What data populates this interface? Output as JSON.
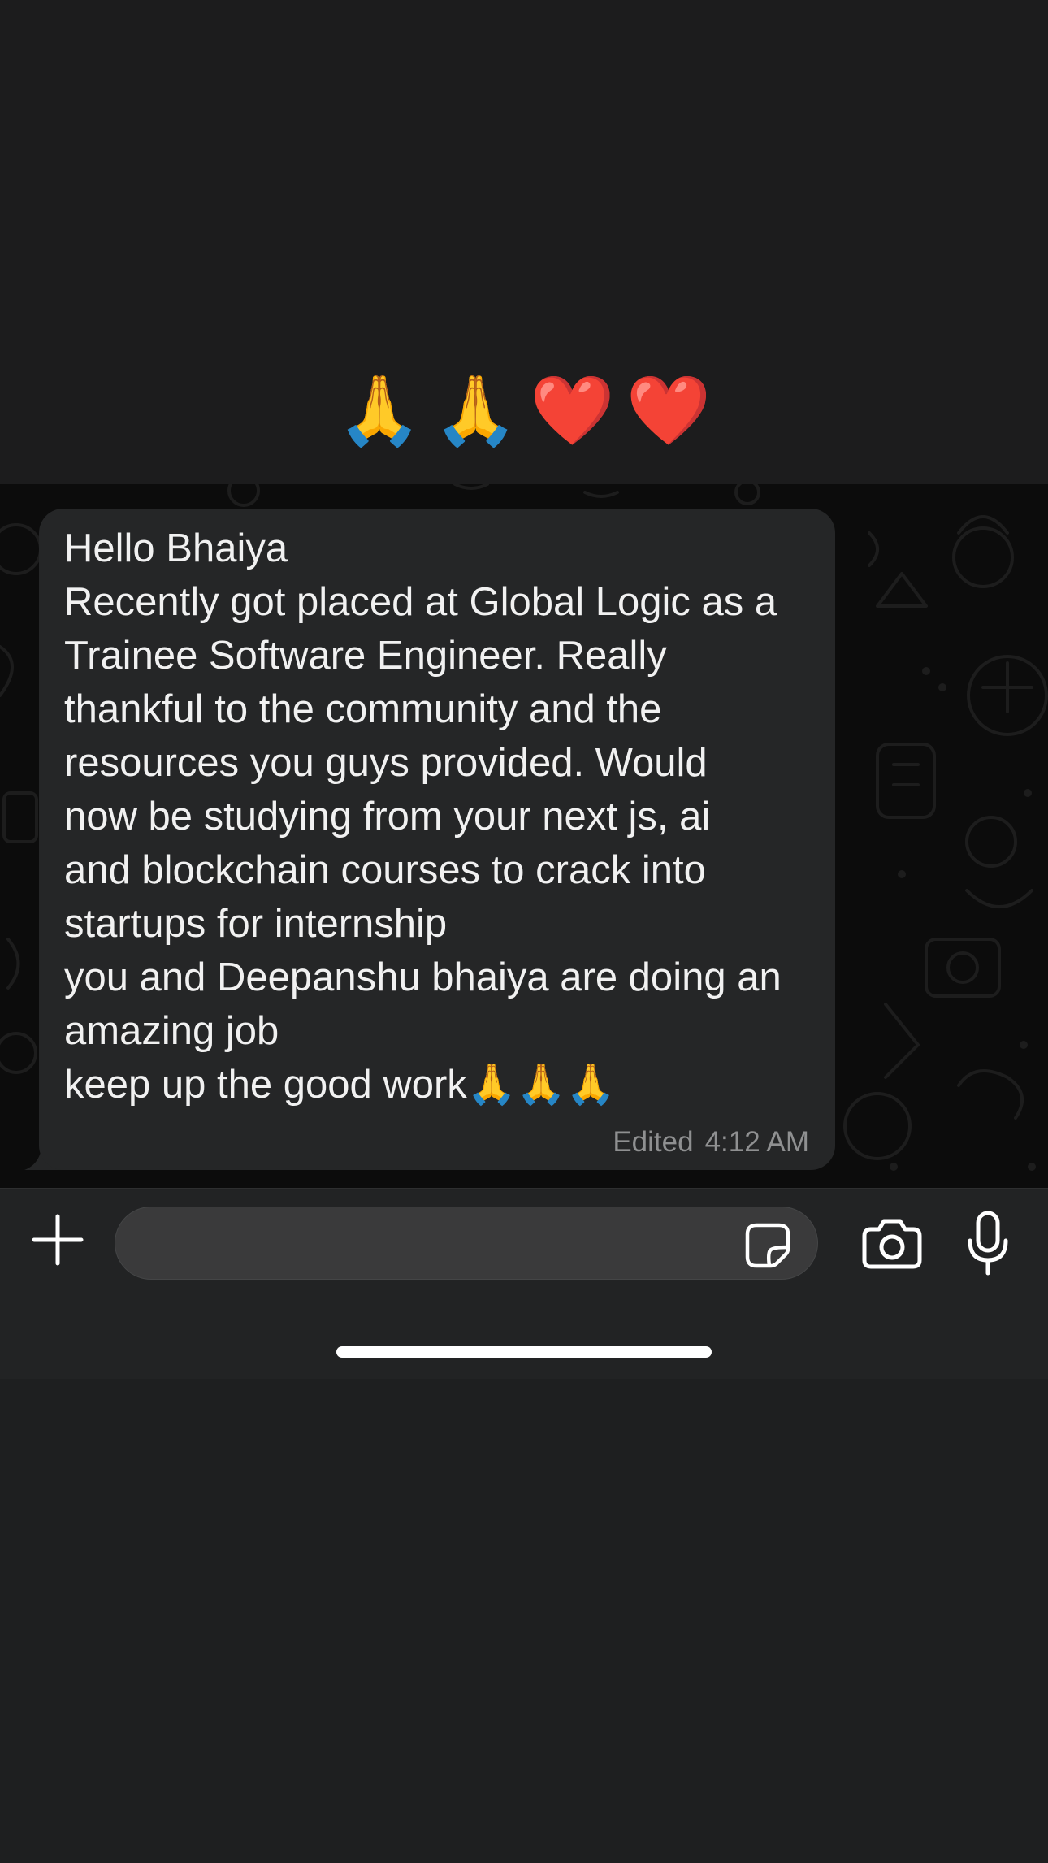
{
  "reactions": [
    "🙏",
    "🙏",
    "❤️",
    "❤️"
  ],
  "message": {
    "lines": [
      "Hello Bhaiya",
      "Recently got placed at Global Logic as a",
      "Trainee Software Engineer. Really",
      "thankful to the community and the",
      "resources you guys provided. Would",
      "now be studying from your next js, ai",
      "and blockchain courses to crack into",
      "startups for internship",
      "you and Deepanshu bhaiya are doing an",
      "amazing job",
      "keep up the good work🙏🙏🙏"
    ],
    "edited_label": "Edited",
    "time": "4:12 AM"
  },
  "composer": {
    "input_value": "",
    "placeholder": ""
  },
  "icons": {
    "add": "plus-icon",
    "sticker": "sticker-icon",
    "camera": "camera-icon",
    "mic": "microphone-icon"
  },
  "colors": {
    "bubble": "#252627",
    "chat_background": "#0c0c0c",
    "composer_background": "#222324",
    "input_background": "#3a3a3b",
    "text": "#f1f1f1",
    "meta_text": "#8f9091"
  }
}
